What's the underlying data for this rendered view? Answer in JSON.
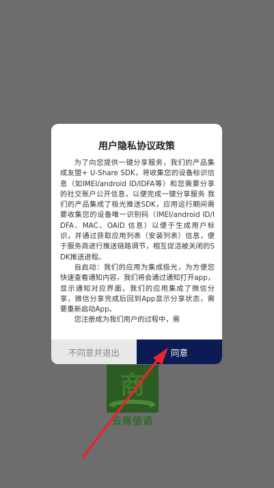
{
  "dialog": {
    "title": "用户隐私协议政策",
    "paragraphs": [
      "为了向您提供一键分享服务，我们的产品集成友盟+ U-Share SDK，将收集您的设备标识信息（如IMEI/android ID/IDFA等）和您需要分享的社交账户公开信息，以便完成一键分享服务    我们的产品集成了极光推送SDK，应用运行期间需要收集您的设备唯一识别码（IMEI/android ID/IDFA、MAC、OAID 信息）以便于生成用户标识，并通过获取应用列表（安装列表）信息，便于服务商进行推送链路调节，相互促活被关闭的SDK推送进程。",
      "自启动：我们的应用为集成极光，为方便您快速查看通知内容，我们将会通过通知打开app，显示通知对应界面。我们的应用集成了微信分享，微信分享完成后回到App显示分享状态，需要重新启动App。",
      "您注册成为我们用户的过程中，需"
    ],
    "decline_label": "不同意并退出",
    "agree_label": "同意"
  },
  "app": {
    "logo_glyph": "商",
    "logo_text": "云商信语"
  },
  "colors": {
    "overlay": "#6d6d6d",
    "agree_button": "#0d1b55",
    "decline_button": "#e8e8e8",
    "annotation_arrow": "#e8262b"
  }
}
